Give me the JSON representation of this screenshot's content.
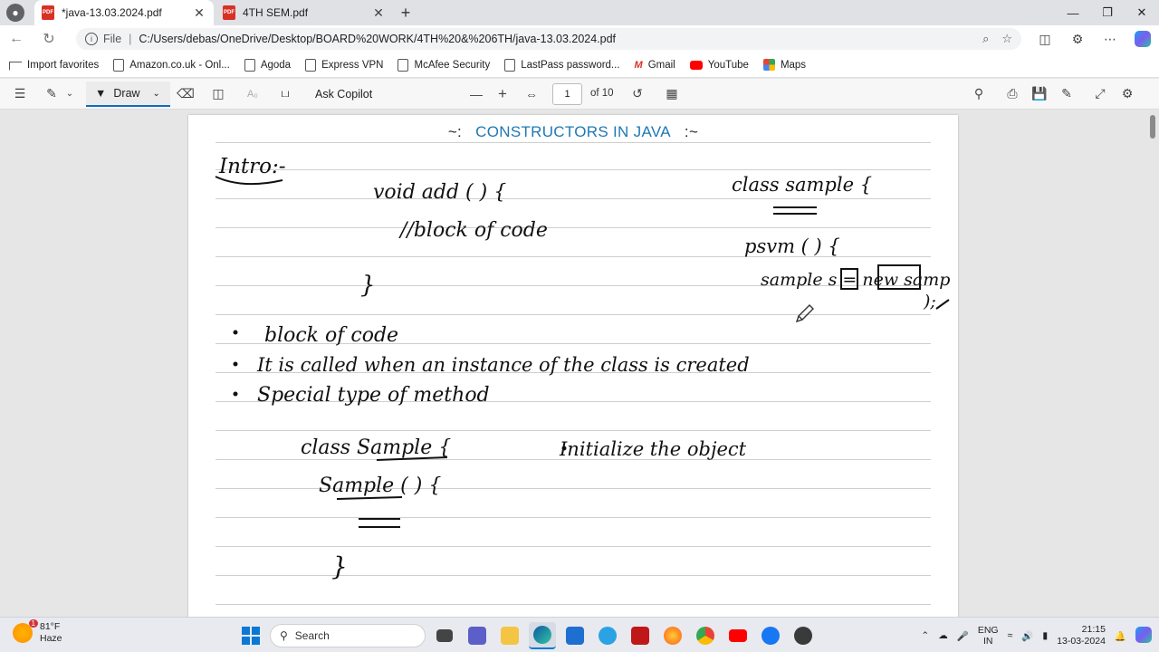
{
  "browser": {
    "tabs": [
      {
        "title": "*java-13.03.2024.pdf",
        "active": true
      },
      {
        "title": "4TH SEM.pdf",
        "active": false
      }
    ],
    "address": {
      "scheme_label": "File",
      "url": "C:/Users/debas/OneDrive/Desktop/BOARD%20WORK/4TH%20&%206TH/java-13.03.2024.pdf"
    },
    "favorites": [
      {
        "label": "Import favorites",
        "icon": "import-icon"
      },
      {
        "label": "Amazon.co.uk - Onl...",
        "icon": "page-icon"
      },
      {
        "label": "Agoda",
        "icon": "page-icon"
      },
      {
        "label": "Express VPN",
        "icon": "page-icon"
      },
      {
        "label": "McAfee Security",
        "icon": "page-icon"
      },
      {
        "label": "LastPass password...",
        "icon": "page-icon"
      },
      {
        "label": "Gmail",
        "icon": "gmail-icon"
      },
      {
        "label": "YouTube",
        "icon": "youtube-icon"
      },
      {
        "label": "Maps",
        "icon": "maps-icon"
      }
    ]
  },
  "pdf_toolbar": {
    "draw_label": "Draw",
    "copilot_label": "Ask Copilot",
    "current_page": "1",
    "page_total": "of 10"
  },
  "document": {
    "title": "CONSTRUCTORS IN JAVA",
    "title_left": "~:",
    "title_right": ":~",
    "handwriting": {
      "heading": "Intro:-",
      "code_line1": "void add ( ) {",
      "code_line2": "//block of code",
      "code_close": "}",
      "right_line1": "class sample {",
      "right_line2": "psvm ( ) {",
      "right_line3": "sample s = new samp",
      "right_close": ");",
      "bullet1": "block of code",
      "bullet2": "It is called when an instance of the class is created",
      "bullet3": "Special type of method",
      "bottom_class": "class Sample {",
      "bottom_ctor": "Sample ( ) {",
      "bottom_close": "}",
      "bottom_bullet": "Initialize the object"
    }
  },
  "taskbar": {
    "weather_temp": "81°F",
    "weather_desc": "Haze",
    "weather_badge": "1",
    "search_placeholder": "Search",
    "lang_top": "ENG",
    "lang_bottom": "IN",
    "time": "21:15",
    "date": "13-03-2024"
  }
}
